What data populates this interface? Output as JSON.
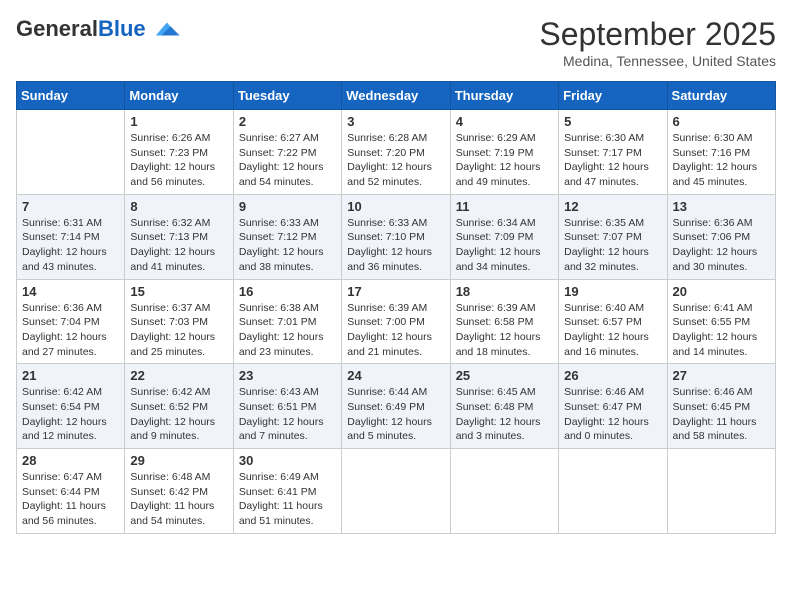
{
  "header": {
    "logo": {
      "general": "General",
      "blue": "Blue"
    },
    "title": "September 2025",
    "location": "Medina, Tennessee, United States"
  },
  "days_of_week": [
    "Sunday",
    "Monday",
    "Tuesday",
    "Wednesday",
    "Thursday",
    "Friday",
    "Saturday"
  ],
  "weeks": [
    [
      {
        "day": "",
        "info": ""
      },
      {
        "day": "1",
        "info": "Sunrise: 6:26 AM\nSunset: 7:23 PM\nDaylight: 12 hours\nand 56 minutes."
      },
      {
        "day": "2",
        "info": "Sunrise: 6:27 AM\nSunset: 7:22 PM\nDaylight: 12 hours\nand 54 minutes."
      },
      {
        "day": "3",
        "info": "Sunrise: 6:28 AM\nSunset: 7:20 PM\nDaylight: 12 hours\nand 52 minutes."
      },
      {
        "day": "4",
        "info": "Sunrise: 6:29 AM\nSunset: 7:19 PM\nDaylight: 12 hours\nand 49 minutes."
      },
      {
        "day": "5",
        "info": "Sunrise: 6:30 AM\nSunset: 7:17 PM\nDaylight: 12 hours\nand 47 minutes."
      },
      {
        "day": "6",
        "info": "Sunrise: 6:30 AM\nSunset: 7:16 PM\nDaylight: 12 hours\nand 45 minutes."
      }
    ],
    [
      {
        "day": "7",
        "info": "Sunrise: 6:31 AM\nSunset: 7:14 PM\nDaylight: 12 hours\nand 43 minutes."
      },
      {
        "day": "8",
        "info": "Sunrise: 6:32 AM\nSunset: 7:13 PM\nDaylight: 12 hours\nand 41 minutes."
      },
      {
        "day": "9",
        "info": "Sunrise: 6:33 AM\nSunset: 7:12 PM\nDaylight: 12 hours\nand 38 minutes."
      },
      {
        "day": "10",
        "info": "Sunrise: 6:33 AM\nSunset: 7:10 PM\nDaylight: 12 hours\nand 36 minutes."
      },
      {
        "day": "11",
        "info": "Sunrise: 6:34 AM\nSunset: 7:09 PM\nDaylight: 12 hours\nand 34 minutes."
      },
      {
        "day": "12",
        "info": "Sunrise: 6:35 AM\nSunset: 7:07 PM\nDaylight: 12 hours\nand 32 minutes."
      },
      {
        "day": "13",
        "info": "Sunrise: 6:36 AM\nSunset: 7:06 PM\nDaylight: 12 hours\nand 30 minutes."
      }
    ],
    [
      {
        "day": "14",
        "info": "Sunrise: 6:36 AM\nSunset: 7:04 PM\nDaylight: 12 hours\nand 27 minutes."
      },
      {
        "day": "15",
        "info": "Sunrise: 6:37 AM\nSunset: 7:03 PM\nDaylight: 12 hours\nand 25 minutes."
      },
      {
        "day": "16",
        "info": "Sunrise: 6:38 AM\nSunset: 7:01 PM\nDaylight: 12 hours\nand 23 minutes."
      },
      {
        "day": "17",
        "info": "Sunrise: 6:39 AM\nSunset: 7:00 PM\nDaylight: 12 hours\nand 21 minutes."
      },
      {
        "day": "18",
        "info": "Sunrise: 6:39 AM\nSunset: 6:58 PM\nDaylight: 12 hours\nand 18 minutes."
      },
      {
        "day": "19",
        "info": "Sunrise: 6:40 AM\nSunset: 6:57 PM\nDaylight: 12 hours\nand 16 minutes."
      },
      {
        "day": "20",
        "info": "Sunrise: 6:41 AM\nSunset: 6:55 PM\nDaylight: 12 hours\nand 14 minutes."
      }
    ],
    [
      {
        "day": "21",
        "info": "Sunrise: 6:42 AM\nSunset: 6:54 PM\nDaylight: 12 hours\nand 12 minutes."
      },
      {
        "day": "22",
        "info": "Sunrise: 6:42 AM\nSunset: 6:52 PM\nDaylight: 12 hours\nand 9 minutes."
      },
      {
        "day": "23",
        "info": "Sunrise: 6:43 AM\nSunset: 6:51 PM\nDaylight: 12 hours\nand 7 minutes."
      },
      {
        "day": "24",
        "info": "Sunrise: 6:44 AM\nSunset: 6:49 PM\nDaylight: 12 hours\nand 5 minutes."
      },
      {
        "day": "25",
        "info": "Sunrise: 6:45 AM\nSunset: 6:48 PM\nDaylight: 12 hours\nand 3 minutes."
      },
      {
        "day": "26",
        "info": "Sunrise: 6:46 AM\nSunset: 6:47 PM\nDaylight: 12 hours\nand 0 minutes."
      },
      {
        "day": "27",
        "info": "Sunrise: 6:46 AM\nSunset: 6:45 PM\nDaylight: 11 hours\nand 58 minutes."
      }
    ],
    [
      {
        "day": "28",
        "info": "Sunrise: 6:47 AM\nSunset: 6:44 PM\nDaylight: 11 hours\nand 56 minutes."
      },
      {
        "day": "29",
        "info": "Sunrise: 6:48 AM\nSunset: 6:42 PM\nDaylight: 11 hours\nand 54 minutes."
      },
      {
        "day": "30",
        "info": "Sunrise: 6:49 AM\nSunset: 6:41 PM\nDaylight: 11 hours\nand 51 minutes."
      },
      {
        "day": "",
        "info": ""
      },
      {
        "day": "",
        "info": ""
      },
      {
        "day": "",
        "info": ""
      },
      {
        "day": "",
        "info": ""
      }
    ]
  ]
}
